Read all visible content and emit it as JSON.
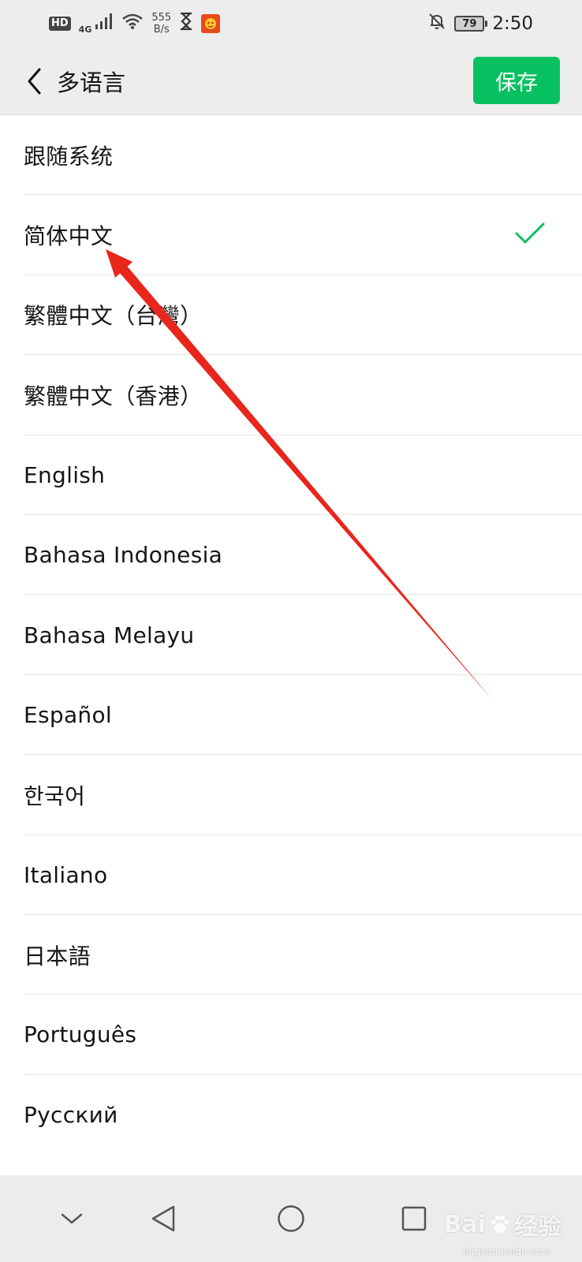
{
  "status_bar": {
    "hd_label": "HD",
    "network_type": "4G",
    "speed_value": "555",
    "speed_unit": "B/s",
    "battery_level": "79",
    "time": "2:50",
    "icons": [
      "hd-icon",
      "signal-icon",
      "wifi-icon",
      "hourglass-icon",
      "app-notification-icon",
      "mute-bell-icon",
      "battery-icon"
    ]
  },
  "header": {
    "title": "多语言",
    "save_label": "保存",
    "back_icon": "chevron-left-icon"
  },
  "languages": [
    {
      "label": "跟随系统",
      "selected": false
    },
    {
      "label": "简体中文",
      "selected": true
    },
    {
      "label": "繁體中文（台灣）",
      "selected": false
    },
    {
      "label": "繁體中文（香港）",
      "selected": false
    },
    {
      "label": "English",
      "selected": false
    },
    {
      "label": "Bahasa Indonesia",
      "selected": false
    },
    {
      "label": "Bahasa Melayu",
      "selected": false
    },
    {
      "label": "Español",
      "selected": false
    },
    {
      "label": "한국어",
      "selected": false
    },
    {
      "label": "Italiano",
      "selected": false
    },
    {
      "label": "日本語",
      "selected": false
    },
    {
      "label": "Português",
      "selected": false
    },
    {
      "label": "Русский",
      "selected": false
    }
  ],
  "colors": {
    "accent": "#07c160",
    "header_bg": "#ededed",
    "annotation_arrow": "#e8261c"
  },
  "nav_bar": {
    "icons": [
      "collapse-chevron-icon",
      "back-triangle-icon",
      "home-circle-icon",
      "recents-square-icon"
    ]
  },
  "watermark": {
    "brand": "Bai",
    "brand_suffix": "经验",
    "url": "jingyan.baidu.com"
  }
}
